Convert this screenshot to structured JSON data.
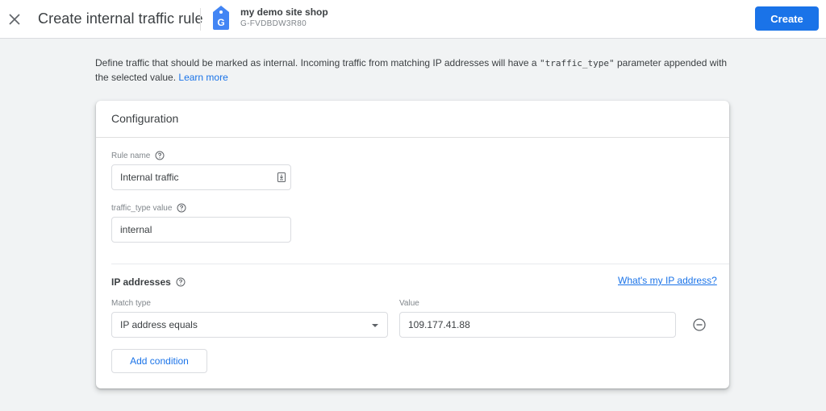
{
  "header": {
    "close_icon": "close-icon",
    "title": "Create internal traffic rule",
    "property": {
      "icon": "google-analytics-tag-icon",
      "icon_glyph": "G",
      "name": "my demo site shop",
      "id": "G-FVDBDW3R80"
    },
    "create_label": "Create"
  },
  "description": {
    "text_before": "Define traffic that should be marked as internal. Incoming traffic from matching IP addresses will have a ",
    "code": "\"traffic_type\"",
    "text_after": " parameter appended with the selected value. ",
    "link": "Learn more"
  },
  "configuration": {
    "title": "Configuration",
    "rule_name": {
      "label": "Rule name",
      "value": "Internal traffic",
      "suffix_icon": "autofill-icon"
    },
    "traffic_type": {
      "label": "traffic_type value",
      "value": "internal"
    },
    "ip_addresses": {
      "title": "IP addresses",
      "whats_my_ip": "What's my IP address?",
      "match_type_label": "Match type",
      "match_type_value": "IP address equals",
      "value_label": "Value",
      "value": "109.177.41.88",
      "remove_icon": "remove-circle-icon",
      "add_condition_label": "Add condition"
    }
  },
  "colors": {
    "accent": "#1a73e8",
    "background": "#f1f3f4",
    "card": "#ffffff"
  }
}
